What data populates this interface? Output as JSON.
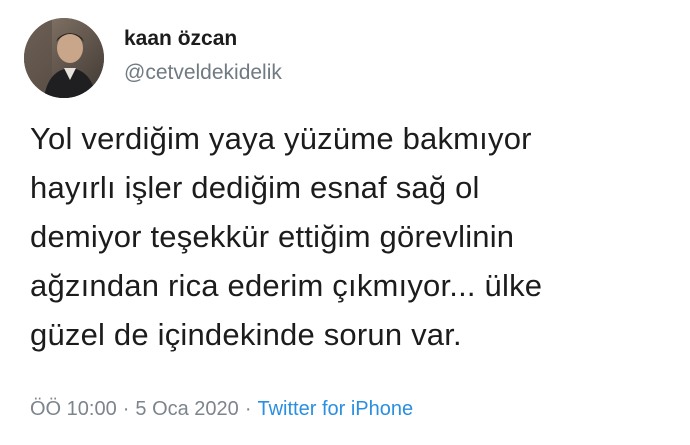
{
  "author": {
    "name": "kaan özcan",
    "handle": "@cetveldekidelik",
    "avatar_icon": "profile-photo"
  },
  "tweet": {
    "lines": [
      "Yol verdiğim yaya yüzüme bakmıyor",
      "hayırlı işler dediğim esnaf sağ ol",
      "demiyor teşekkür ettiğim görevlinin",
      "ağzından rica ederim çıkmıyor... ülke",
      "güzel de içindekinde sorun var."
    ]
  },
  "meta": {
    "time": "ÖÖ 10:00",
    "separator": "·",
    "date": "5 Oca 2020",
    "source": "Twitter for iPhone"
  },
  "colors": {
    "text": "#1c1c1c",
    "secondary": "#707a82",
    "link": "#2a8fe0",
    "background": "#ffffff"
  }
}
